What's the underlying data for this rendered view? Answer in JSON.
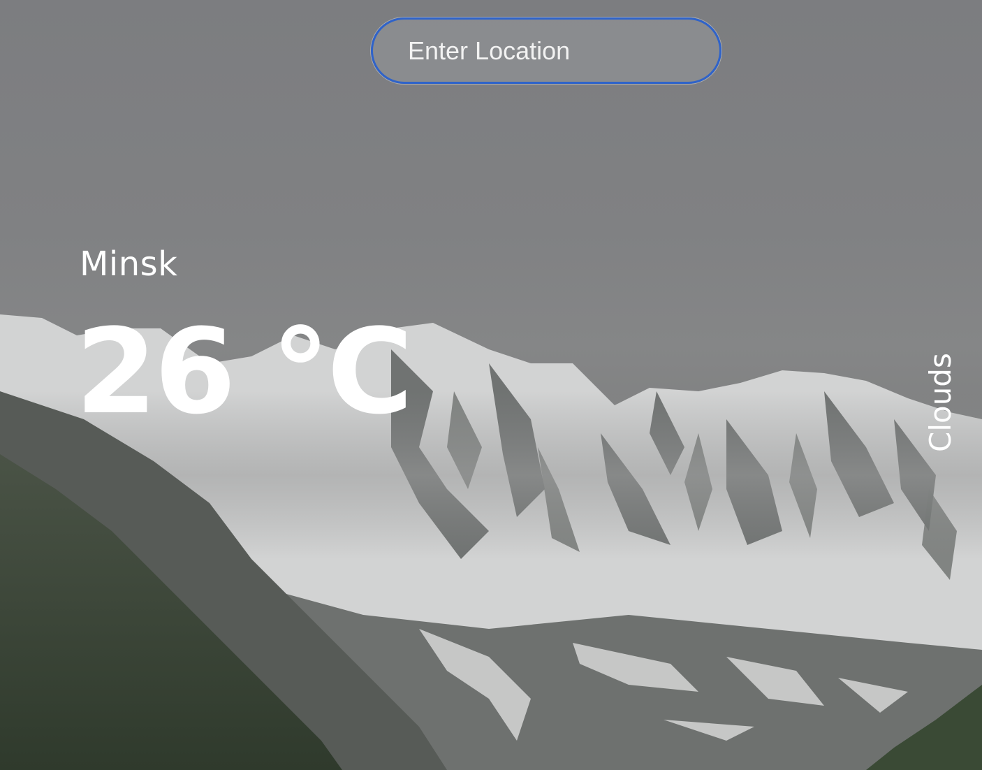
{
  "search": {
    "placeholder": "Enter Location",
    "value": ""
  },
  "weather": {
    "city": "Minsk",
    "temperature": "26 °C",
    "condition": "Clouds"
  },
  "colors": {
    "search_border": "#2f63c9",
    "text": "#ffffff",
    "sky": "#808183",
    "snow": "#d8d9d9",
    "rock": "#5e615f",
    "grass": "#3d4739"
  },
  "background": {
    "scene": "snowy-mountains-fog"
  }
}
